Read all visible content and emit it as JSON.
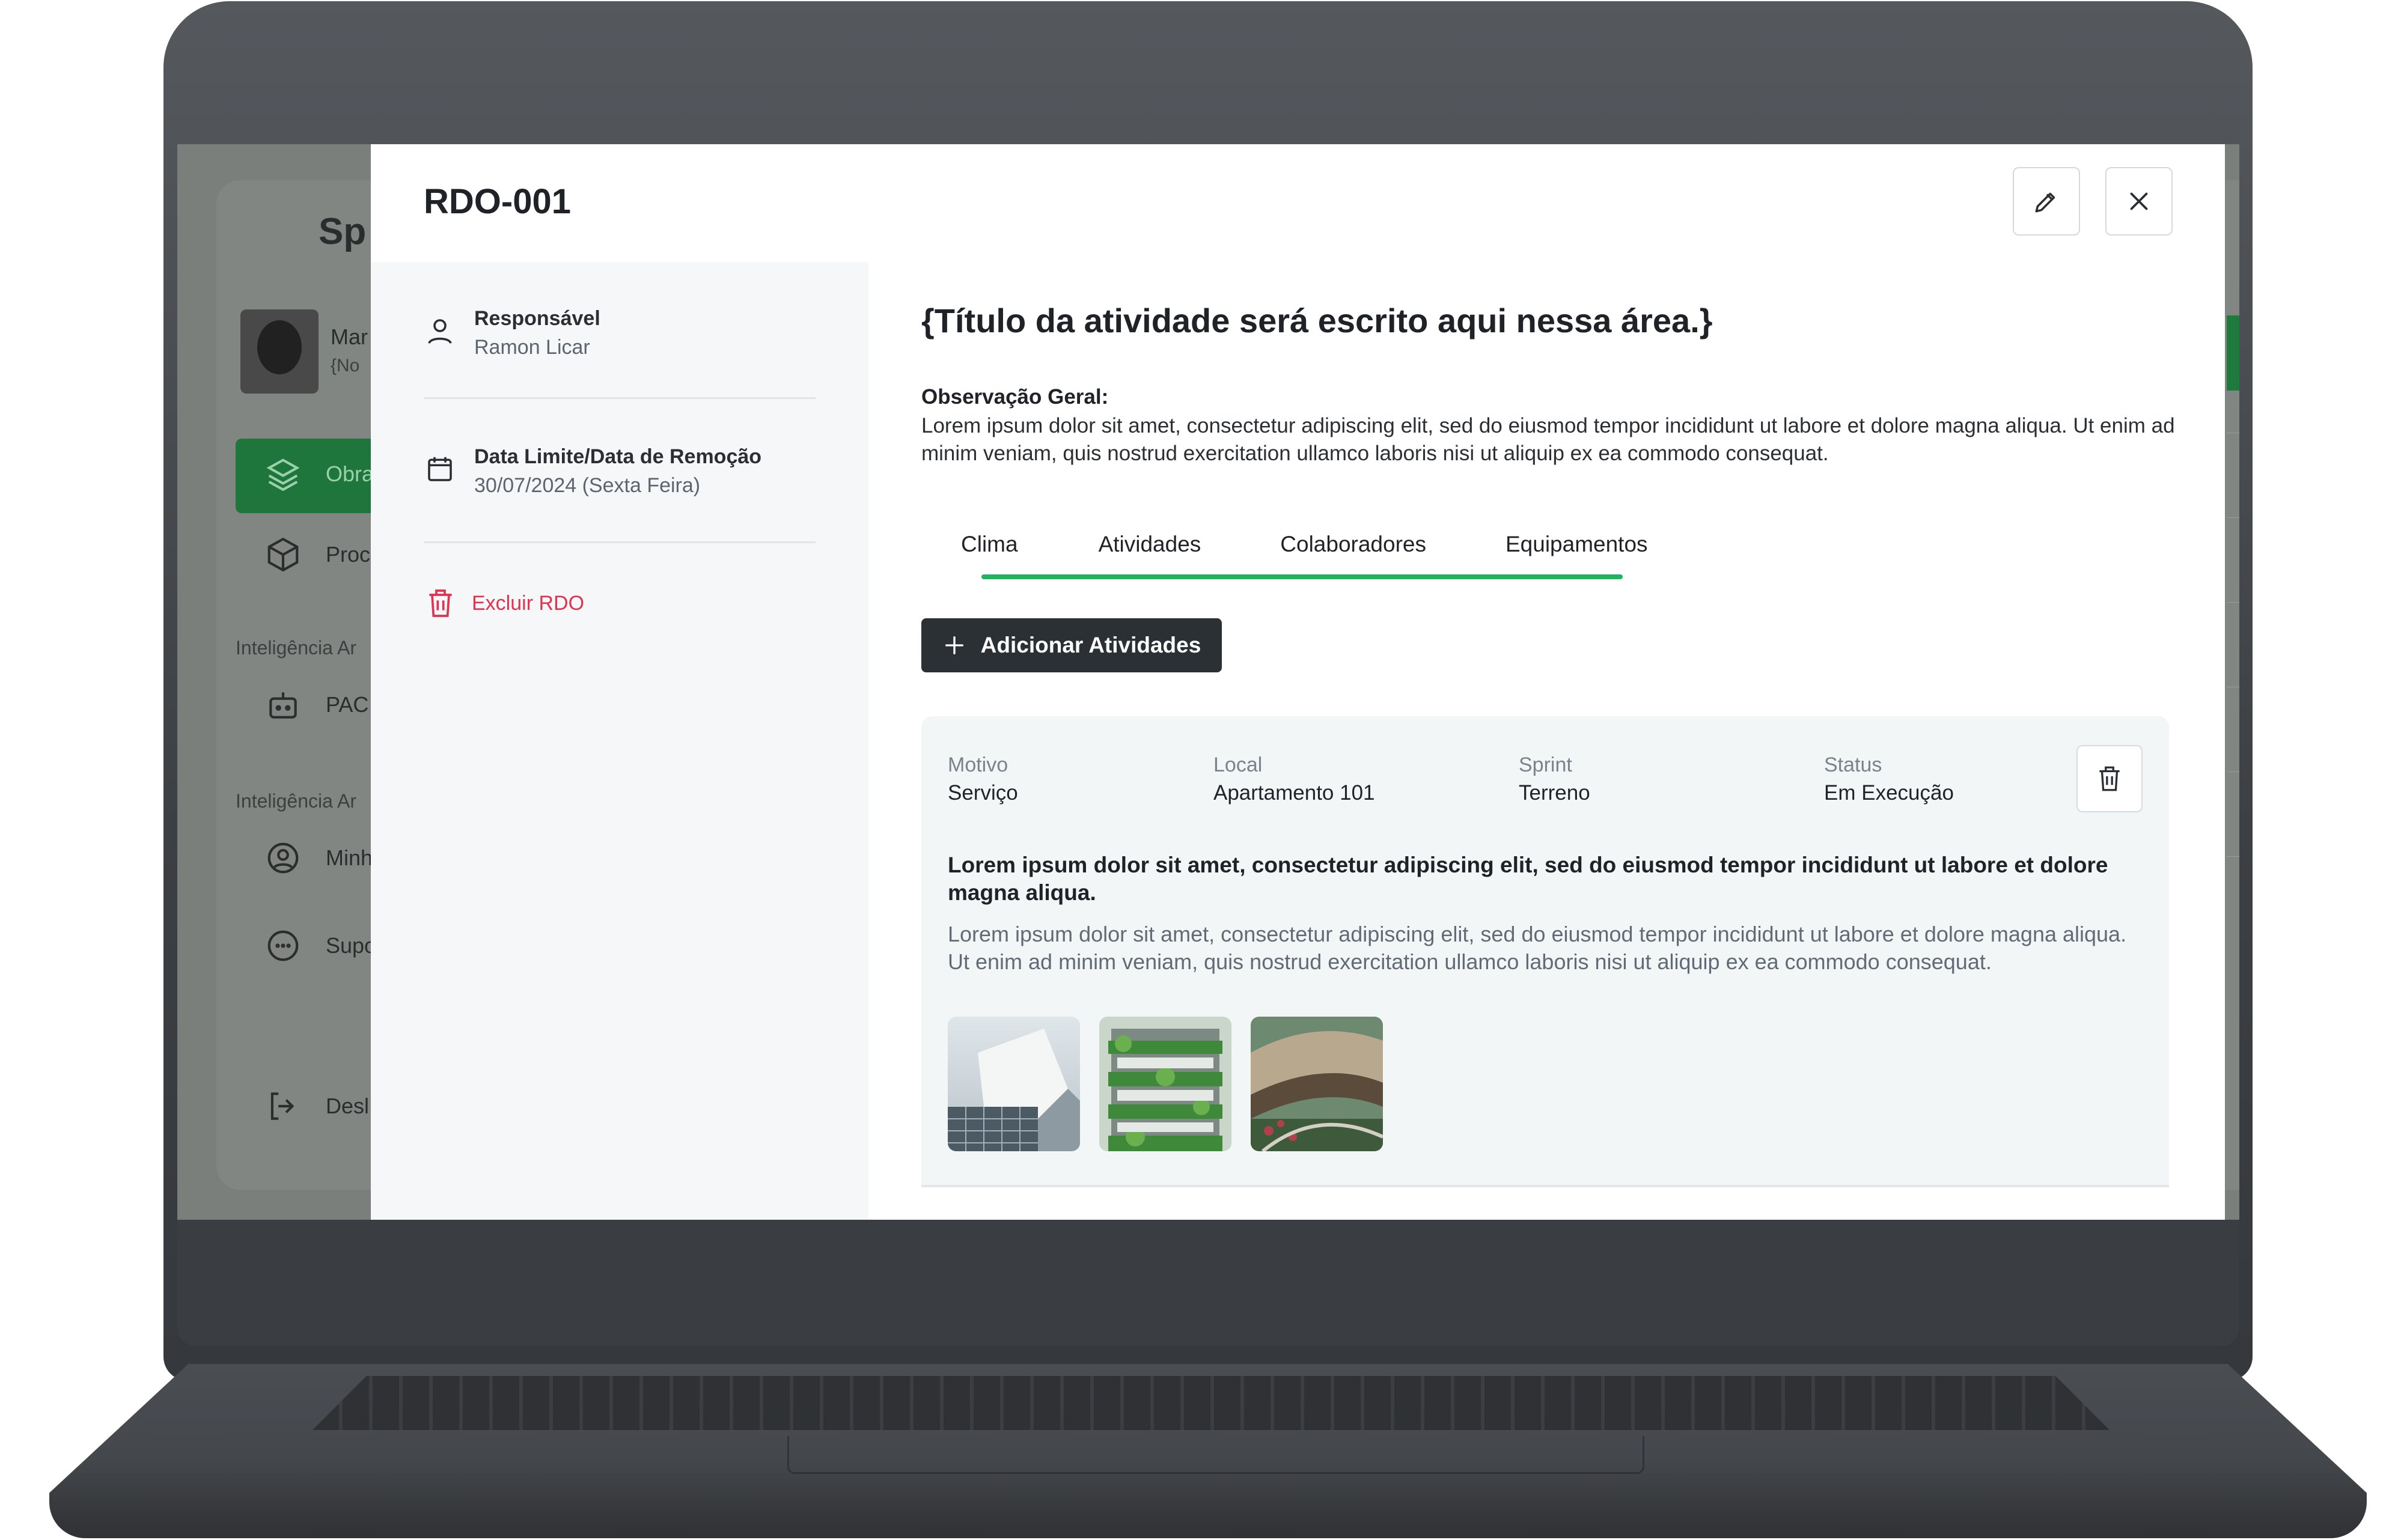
{
  "background_app": {
    "logo": "Sp",
    "user_name": "Mar",
    "user_sub": "{No",
    "nav": [
      {
        "label": "Obra",
        "icon": "layers-icon",
        "active": true
      },
      {
        "label": "Proc",
        "icon": "box-icon"
      },
      {
        "label": "PAC",
        "icon": "robot-icon"
      },
      {
        "label": "Minh",
        "icon": "user-circle-icon"
      },
      {
        "label": "Supo",
        "icon": "chat-icon"
      },
      {
        "label": "Desl",
        "icon": "logout-icon"
      }
    ],
    "sections": [
      "Inteligência Ar",
      "Inteligência Ar"
    ]
  },
  "modal": {
    "title": "RDO-001",
    "edit_icon": "pencil-icon",
    "close_icon": "close-icon"
  },
  "left": {
    "responsavel_label": "Responsável",
    "responsavel_value": "Ramon Licar",
    "data_label": "Data Limite/Data de Remoção",
    "data_value": "30/07/2024 (Sexta Feira)",
    "delete_label": "Excluir RDO"
  },
  "main": {
    "title": "{Título da atividade será escrito aqui nessa área.}",
    "obs_label": "Observação Geral:",
    "obs_text": "Lorem ipsum dolor sit amet, consectetur adipiscing elit, sed do eiusmod tempor incididunt ut labore et dolore magna aliqua. Ut enim ad minim veniam, quis nostrud exercitation ullamco laboris nisi ut aliquip ex ea commodo consequat.",
    "tabs": [
      "Clima",
      "Atividades",
      "Colaboradores",
      "Equipamentos"
    ],
    "add_button": "Adicionar Atividades"
  },
  "activity": {
    "motivo_label": "Motivo",
    "motivo_value": "Serviço",
    "local_label": "Local",
    "local_value": "Apartamento 101",
    "sprint_label": "Sprint",
    "sprint_value": "Terreno",
    "status_label": "Status",
    "status_value": "Em Execução",
    "strong_text": "Lorem ipsum dolor sit amet, consectetur adipiscing elit, sed do eiusmod tempor incididunt ut labore et dolore magna aliqua.",
    "body_text": "Lorem ipsum dolor sit amet, consectetur adipiscing elit, sed do eiusmod tempor incididunt ut labore et dolore magna aliqua. Ut enim ad minim veniam, quis nostrud exercitation ullamco laboris nisi ut aliquip ex ea commodo consequat."
  },
  "colors": {
    "accent_green": "#22b35e",
    "danger": "#e0334f",
    "dark_button": "#2b3034"
  }
}
